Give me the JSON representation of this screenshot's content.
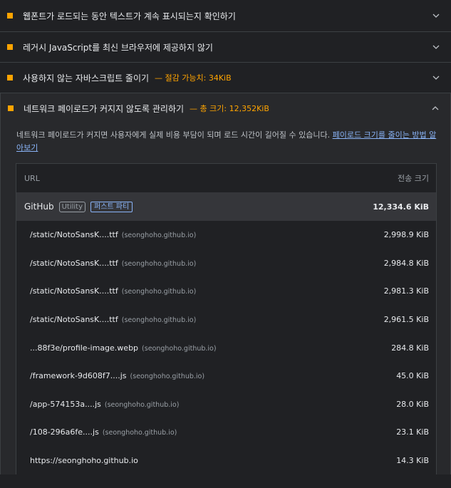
{
  "colors": {
    "accent": "#ffa400",
    "link": "#8ab4f8",
    "background": "#202124"
  },
  "audits": [
    {
      "title": "웹폰트가 로드되는 동안 텍스트가 계속 표시되는지 확인하기",
      "extra": ""
    },
    {
      "title": "레거시 JavaScript를 최신 브라우저에 제공하지 않기",
      "extra": ""
    },
    {
      "title": "사용하지 않는 자바스크립트 줄이기",
      "extra": "— 절감 가능치: 34KiB"
    }
  ],
  "open_audit": {
    "title": "네트워크 페이로드가 커지지 않도록 관리하기",
    "extra": "— 총 크기: 12,352KiB",
    "description": "네트워크 페이로드가 커지면 사용자에게 실제 비용 부담이 되며 로드 시간이 길어질 수 있습니다.",
    "link": "페이로드 크기를 줄이는 방법 알아보기",
    "table": {
      "col_url": "URL",
      "col_size": "전송 크기",
      "group": {
        "name": "GitHub",
        "badge_utility": "Utility",
        "badge_first": "퍼스트 파티",
        "size": "12,334.6 KiB"
      },
      "rows": [
        {
          "url": "/static/NotoSansK....ttf",
          "host": "(seonghoho.github.io)",
          "size": "2,998.9 KiB"
        },
        {
          "url": "/static/NotoSansK....ttf",
          "host": "(seonghoho.github.io)",
          "size": "2,984.8 KiB"
        },
        {
          "url": "/static/NotoSansK....ttf",
          "host": "(seonghoho.github.io)",
          "size": "2,981.3 KiB"
        },
        {
          "url": "/static/NotoSansK....ttf",
          "host": "(seonghoho.github.io)",
          "size": "2,961.5 KiB"
        },
        {
          "url": "...88f3e/profile-image.webp",
          "host": "(seonghoho.github.io)",
          "size": "284.8 KiB"
        },
        {
          "url": "/framework-9d608f7....js",
          "host": "(seonghoho.github.io)",
          "size": "45.0 KiB"
        },
        {
          "url": "/app-574153a....js",
          "host": "(seonghoho.github.io)",
          "size": "28.0 KiB"
        },
        {
          "url": "/108-296a6fe....js",
          "host": "(seonghoho.github.io)",
          "size": "23.1 KiB"
        },
        {
          "url": "https://seonghoho.github.io",
          "host": "",
          "size": "14.3 KiB"
        }
      ]
    }
  }
}
